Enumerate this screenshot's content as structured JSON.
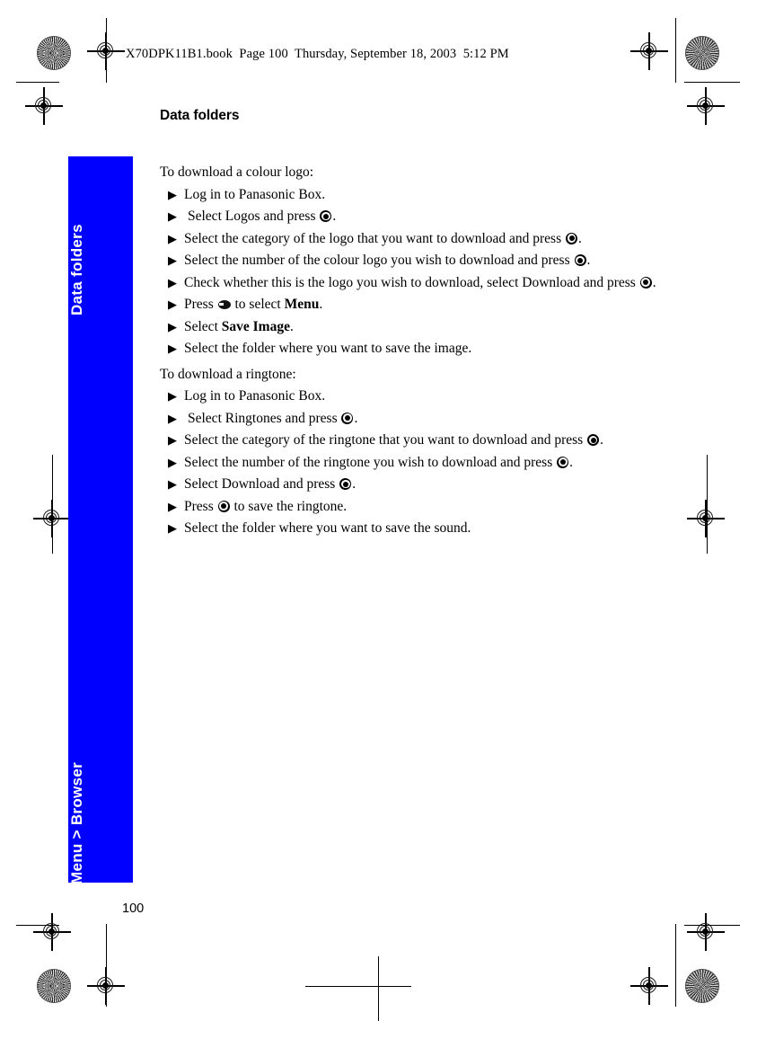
{
  "header": {
    "running_text": "X70DPK11B1.book  Page 100  Thursday, September 18, 2003  5:12 PM"
  },
  "side_tab": {
    "color": "#0000FF",
    "top_label": "Data folders",
    "bottom_label": "Menu > Browser"
  },
  "page": {
    "title": "Data folders",
    "folio": "100"
  },
  "icons": {
    "select_key": "select-key-icon",
    "menu_key": "menu-key-icon",
    "bullet": "▶",
    "registration_target": "registration-target-icon",
    "registration_star": "registration-starburst-icon"
  },
  "sections": [
    {
      "intro": "To download a colour logo:",
      "steps": [
        {
          "parts": [
            {
              "t": "text",
              "v": "Log in to Panasonic Box."
            }
          ]
        },
        {
          "lead_space": true,
          "parts": [
            {
              "t": "text",
              "v": "Select Logos and press "
            },
            {
              "t": "key-select"
            },
            {
              "t": "text",
              "v": "."
            }
          ]
        },
        {
          "parts": [
            {
              "t": "text",
              "v": "Select the category of the logo that you want to download and press "
            },
            {
              "t": "key-select"
            },
            {
              "t": "text",
              "v": "."
            }
          ]
        },
        {
          "parts": [
            {
              "t": "text",
              "v": "Select the number of the colour logo you wish to download and press "
            },
            {
              "t": "key-select"
            },
            {
              "t": "text",
              "v": "."
            }
          ]
        },
        {
          "parts": [
            {
              "t": "text",
              "v": "Check whether this is the logo you wish to download, select Download and press "
            },
            {
              "t": "key-select"
            },
            {
              "t": "text",
              "v": "."
            }
          ]
        },
        {
          "parts": [
            {
              "t": "text",
              "v": "Press "
            },
            {
              "t": "key-menu"
            },
            {
              "t": "text",
              "v": " to select "
            },
            {
              "t": "bold",
              "v": "Menu"
            },
            {
              "t": "text",
              "v": "."
            }
          ]
        },
        {
          "parts": [
            {
              "t": "text",
              "v": "Select "
            },
            {
              "t": "bold",
              "v": "Save Image"
            },
            {
              "t": "text",
              "v": "."
            }
          ]
        },
        {
          "parts": [
            {
              "t": "text",
              "v": "Select the folder where you want to save the image."
            }
          ]
        }
      ]
    },
    {
      "intro": "To download a ringtone:",
      "steps": [
        {
          "parts": [
            {
              "t": "text",
              "v": "Log in to Panasonic Box."
            }
          ]
        },
        {
          "lead_space": true,
          "parts": [
            {
              "t": "text",
              "v": "Select Ringtones and press "
            },
            {
              "t": "key-select"
            },
            {
              "t": "text",
              "v": "."
            }
          ]
        },
        {
          "parts": [
            {
              "t": "text",
              "v": "Select the category of the ringtone that you want to download and press "
            },
            {
              "t": "key-select"
            },
            {
              "t": "text",
              "v": "."
            }
          ]
        },
        {
          "parts": [
            {
              "t": "text",
              "v": "Select the number of the ringtone you wish to download and press "
            },
            {
              "t": "key-select"
            },
            {
              "t": "text",
              "v": "."
            }
          ]
        },
        {
          "parts": [
            {
              "t": "text",
              "v": "Select Download and press "
            },
            {
              "t": "key-select"
            },
            {
              "t": "text",
              "v": "."
            }
          ]
        },
        {
          "parts": [
            {
              "t": "text",
              "v": "Press "
            },
            {
              "t": "key-select"
            },
            {
              "t": "text",
              "v": " to save the ringtone."
            }
          ]
        },
        {
          "parts": [
            {
              "t": "text",
              "v": "Select the folder where you want to save the sound."
            }
          ]
        }
      ]
    }
  ]
}
